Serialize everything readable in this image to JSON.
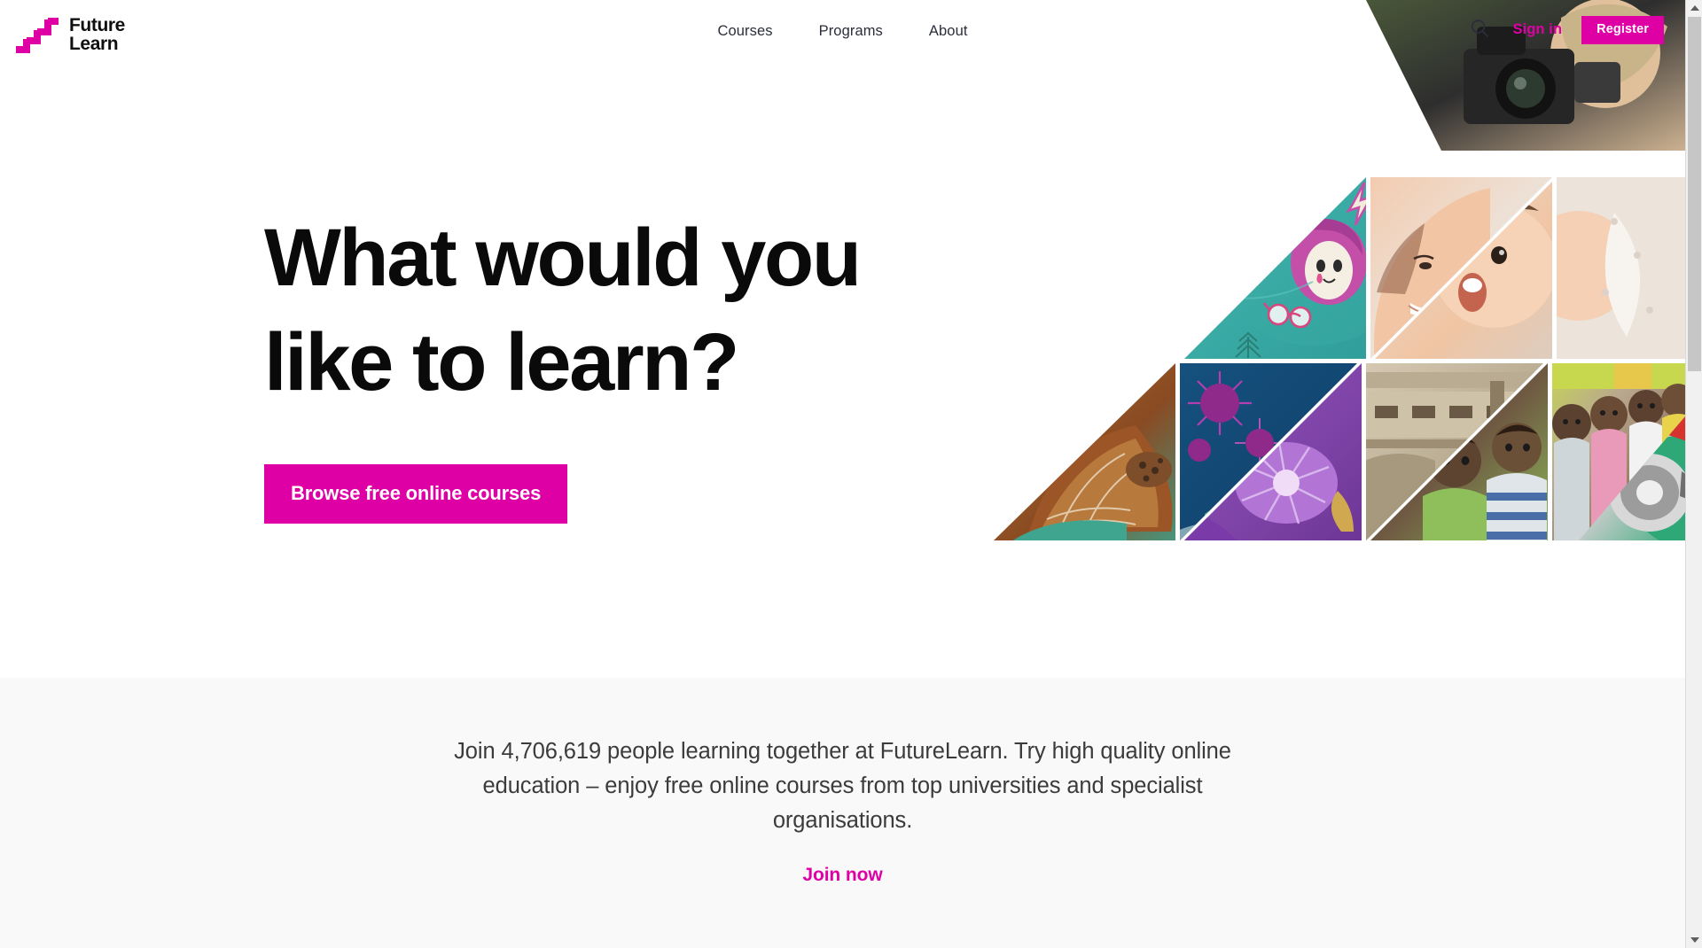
{
  "brand": {
    "name": "FutureLearn",
    "logo_line1": "Future",
    "logo_line2": "Learn",
    "accent_color": "#DE00A5",
    "text_color": "#0f0f0f"
  },
  "header": {
    "nav": [
      {
        "label": "Courses"
      },
      {
        "label": "Programs"
      },
      {
        "label": "About"
      }
    ],
    "search_icon": "search-icon",
    "signin_label": "Sign in",
    "register_label": "Register"
  },
  "hero": {
    "title_line1": "What would you",
    "title_line2": "like to learn?",
    "cta_label": "Browse free online courses",
    "background_color": "#ffffff"
  },
  "mosaic": {
    "description": "Triangular photo collage of course subject imagery",
    "tiles": [
      {
        "name": "woman-with-video-camera",
        "colors": [
          "#3c3c3c",
          "#d9c2a4",
          "#2f4a2a"
        ]
      },
      {
        "name": "teal-illustration-character",
        "colors": [
          "#3db3ad",
          "#c449a1",
          "#f2ece0"
        ]
      },
      {
        "name": "mother-smiling-at-baby",
        "colors": [
          "#e8ddd4",
          "#f0c9ad",
          "#d8cfc6"
        ]
      },
      {
        "name": "blue-underwater-coral",
        "colors": [
          "#14517c",
          "#9b2f8f",
          "#5ec2b3"
        ]
      },
      {
        "name": "sea-turtle",
        "colors": [
          "#8c4a21",
          "#3fa58e",
          "#c9a87a"
        ]
      },
      {
        "name": "purple-flower",
        "colors": [
          "#8a4bb5",
          "#c78ad6",
          "#5b2f86"
        ]
      },
      {
        "name": "children-by-concrete-building",
        "colors": [
          "#cdc0aa",
          "#7d6a52",
          "#8fbf5a"
        ]
      },
      {
        "name": "group-of-children",
        "colors": [
          "#c9d84a",
          "#e8a9c3",
          "#6b4a35"
        ]
      },
      {
        "name": "person-with-megaphone",
        "colors": [
          "#d6332e",
          "#2fa878",
          "#c8c8c8"
        ]
      }
    ]
  },
  "promo": {
    "text": "Join 4,706,619 people learning together at FutureLearn. Try high quality online education – enjoy free online courses from top universities and specialist organisations.",
    "learner_count": "4,706,619",
    "link_label": "Join now",
    "background_color": "#F9F9F9"
  },
  "scrollbar": {
    "up_arrow": "scroll-up-arrow",
    "down_arrow": "scroll-down-arrow",
    "thumb": "scroll-thumb"
  }
}
